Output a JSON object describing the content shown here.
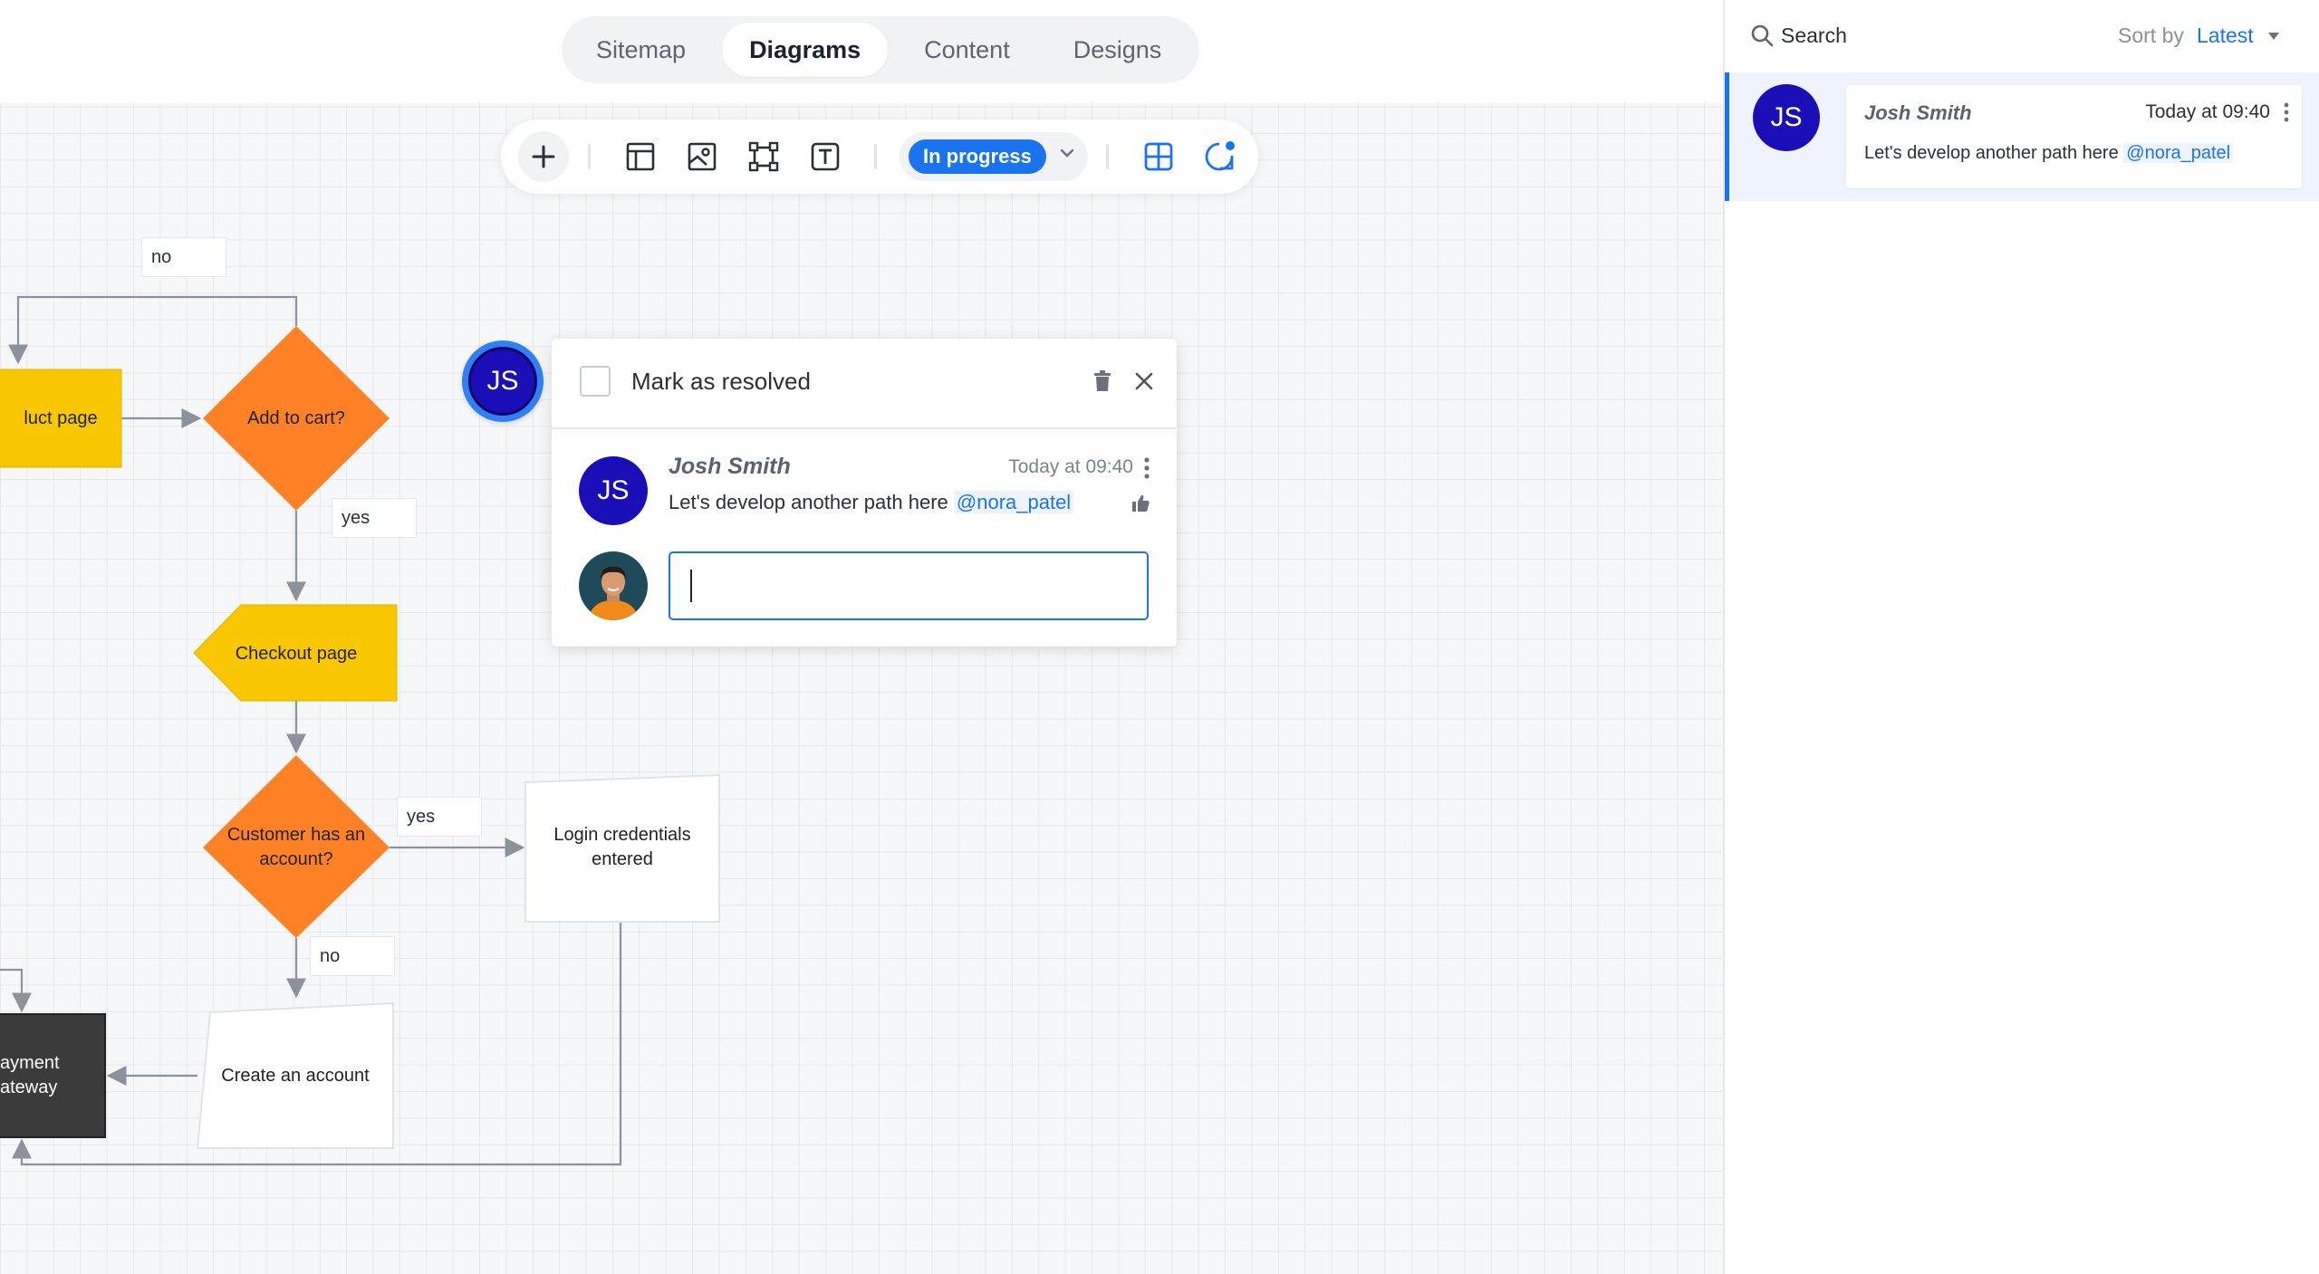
{
  "tabs": [
    {
      "label": "Sitemap",
      "active": false
    },
    {
      "label": "Diagrams",
      "active": true
    },
    {
      "label": "Content",
      "active": false
    },
    {
      "label": "Designs",
      "active": false
    }
  ],
  "toolbar": {
    "icons": [
      "plus-icon",
      "layout-icon",
      "image-frame-icon",
      "frame-icon",
      "text-tool-icon",
      "grid-view-icon",
      "comment-icon"
    ],
    "status_label": "In progress",
    "accent_color": "#1b74ef"
  },
  "diagram": {
    "labels": {
      "no_top": "no",
      "yes_mid": "yes",
      "yes_right": "yes",
      "no_bottom": "no"
    },
    "nodes": {
      "product_page": "luct page",
      "add_to_cart": "Add to cart?",
      "checkout_page": "Checkout page",
      "customer_account_line1": "Customer has an",
      "customer_account_line2": "account?",
      "login_line1": "Login credentials",
      "login_line2": "entered",
      "create_account": "Create an account",
      "payment_line1": "ayment",
      "payment_line2": "ateway"
    },
    "colors": {
      "diamond": "#ff8125",
      "yellow": "#f9c700",
      "dark": "#3b3b3b"
    }
  },
  "marker": {
    "initials": "JS"
  },
  "popover": {
    "resolve_label": "Mark as resolved",
    "comment": {
      "initials": "JS",
      "author": "Josh Smith",
      "time": "Today at 09:40",
      "text": "Let's develop another path here",
      "mention": "@nora_patel"
    },
    "reply_value": ""
  },
  "panel": {
    "search_label": "Search",
    "sort_label": "Sort by",
    "sort_value": "Latest",
    "thread": {
      "initials": "JS",
      "author": "Josh Smith",
      "time": "Today at 09:40",
      "text": "Let's develop another path here",
      "mention": "@nora_patel"
    }
  }
}
